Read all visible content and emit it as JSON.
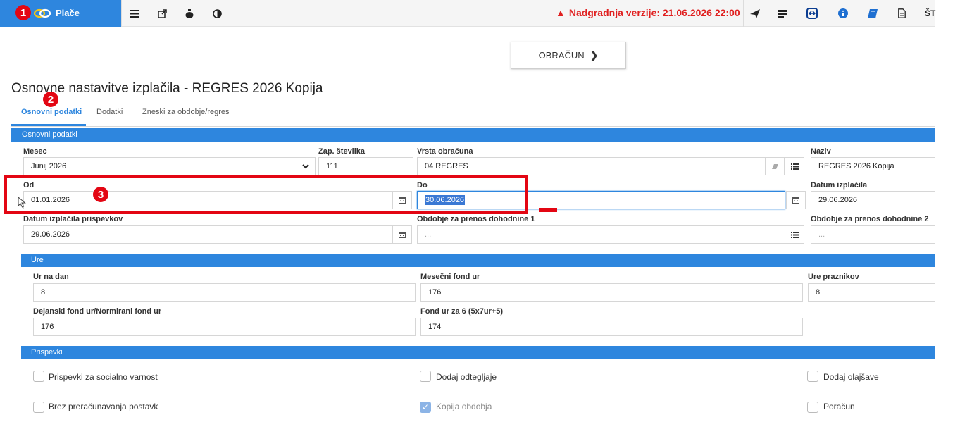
{
  "topbar": {
    "app_name": "Plače",
    "upgrade_notice": "Nadgradnja verzije: 21.06.2026 22:00",
    "right_label": "ŠT",
    "left_icons": [
      "list-icon",
      "external-link-icon",
      "money-bag-icon",
      "contrast-icon"
    ],
    "right_icons": [
      "send-icon",
      "news-icon",
      "teamviewer-icon",
      "info-icon",
      "book-icon",
      "document-icon"
    ]
  },
  "callouts": {
    "one": "1",
    "two": "2",
    "three": "3"
  },
  "actions": {
    "obracun_label": "OBRAČUN"
  },
  "page": {
    "title": "Osnovne nastavitve izplačila - REGRES 2026 Kopija"
  },
  "tabs": [
    {
      "label": "Osnovni podatki",
      "active": true
    },
    {
      "label": "Dodatki",
      "active": false
    },
    {
      "label": "Zneski za obdobje/regres",
      "active": false
    }
  ],
  "sections": {
    "osnovni": "Osnovni podatki",
    "ure": "Ure",
    "prispevki": "Prispevki"
  },
  "osnovni": {
    "mesec": {
      "label": "Mesec",
      "value": "Junij 2026"
    },
    "zap_stevilka": {
      "label": "Zap. številka",
      "value": "111"
    },
    "vrsta_obracuna": {
      "label": "Vrsta obračuna",
      "value": "04 REGRES"
    },
    "naziv": {
      "label": "Naziv",
      "value": "REGRES 2026 Kopija"
    },
    "od": {
      "label": "Od",
      "value": "01.01.2026"
    },
    "do": {
      "label": "Do",
      "value": "30.06.2026"
    },
    "datum_izplacila": {
      "label": "Datum izplačila",
      "value": "29.06.2026"
    },
    "datum_izplacila_prispevkov": {
      "label": "Datum izplačila prispevkov",
      "value": "29.06.2026"
    },
    "obdobje_prenos_1": {
      "label": "Obdobje za prenos dohodnine 1",
      "placeholder": "..."
    },
    "obdobje_prenos_2": {
      "label": "Obdobje za prenos dohodnine 2",
      "placeholder": "..."
    }
  },
  "ure": {
    "ur_na_dan": {
      "label": "Ur na dan",
      "value": "8"
    },
    "mesecni_fond": {
      "label": "Mesečni fond ur",
      "value": "176"
    },
    "ure_praznikov": {
      "label": "Ure praznikov",
      "value": "8"
    },
    "dejanski_fond": {
      "label": "Dejanski fond ur/Normirani fond ur",
      "value": "176"
    },
    "fond_za_6": {
      "label": "Fond ur za 6 (5x7ur+5)",
      "value": "174"
    }
  },
  "prispevki": {
    "items": [
      {
        "label": "Prispevki za socialno varnost",
        "checked": false
      },
      {
        "label": "Dodaj odtegljaje",
        "checked": false
      },
      {
        "label": "Dodaj olajšave",
        "checked": false
      },
      {
        "label": "Brez preračunavanja postavk",
        "checked": false
      },
      {
        "label": "Kopija obdobja",
        "checked": true
      },
      {
        "label": "Poračun",
        "checked": false
      }
    ]
  },
  "colors": {
    "accent": "#2e86de",
    "alert": "#e02020",
    "annotation": "#e30613"
  }
}
